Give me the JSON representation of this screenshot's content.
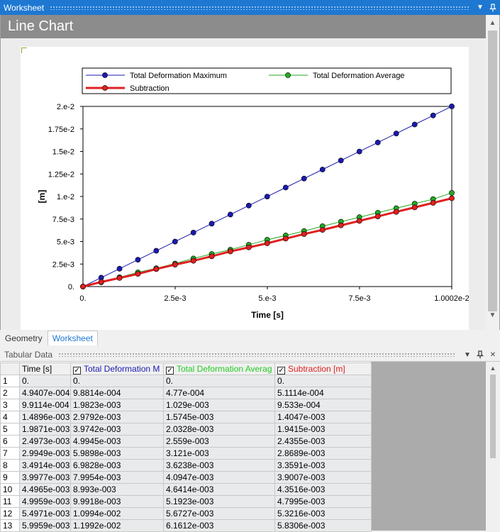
{
  "worksheet": {
    "title": "Worksheet",
    "pin_icon": "pin-icon",
    "dropdown_icon": "dropdown-arrow-icon",
    "header": "Line Chart"
  },
  "chart_data": {
    "type": "line",
    "xlabel": "Time [s]",
    "ylabel": "[m]",
    "xlim": [
      0,
      0.010002
    ],
    "ylim": [
      0,
      0.02
    ],
    "x_ticks": [
      0,
      0.0025,
      0.005,
      0.0075,
      0.010002
    ],
    "x_tick_labels": [
      "0.",
      "2.5e-3",
      "5.e-3",
      "7.5e-3",
      "1.0002e-2"
    ],
    "y_ticks": [
      0,
      0.0025,
      0.005,
      0.0075,
      0.01,
      0.0125,
      0.015,
      0.0175,
      0.02
    ],
    "y_tick_labels": [
      "0.",
      "2.5e-3",
      "5.e-3",
      "7.5e-3",
      "1.e-2",
      "1.25e-2",
      "1.5e-2",
      "1.75e-2",
      "2.e-2"
    ],
    "legend_position": "top",
    "x": [
      0,
      0.00049407,
      0.00099114,
      0.0014896,
      0.0019871,
      0.0024973,
      0.0029949,
      0.0034914,
      0.0039977,
      0.0044965,
      0.0049959,
      0.0054971,
      0.0059959,
      0.0064959,
      0.0069959,
      0.0074959,
      0.0079959,
      0.0084959,
      0.0089959,
      0.0094959,
      0.010002
    ],
    "series": [
      {
        "name": "Total Deformation Maximum",
        "color": "#1a1ab0",
        "values": [
          0,
          0.00098814,
          0.0019823,
          0.0029792,
          0.0039742,
          0.0049945,
          0.0059898,
          0.0069828,
          0.0079954,
          0.008993,
          0.0099918,
          0.010994,
          0.011992,
          0.012992,
          0.013992,
          0.014992,
          0.015992,
          0.016992,
          0.017992,
          0.018992,
          0.020004
        ]
      },
      {
        "name": "Total Deformation Average",
        "color": "#22aa22",
        "values": [
          0,
          0.000477,
          0.001029,
          0.0015745,
          0.0020328,
          0.002559,
          0.003121,
          0.0036238,
          0.0040947,
          0.0046414,
          0.0051923,
          0.0056727,
          0.0061612,
          0.0067,
          0.0072,
          0.0077,
          0.0082,
          0.0087,
          0.0092,
          0.0097,
          0.0104
        ]
      },
      {
        "name": "Subtraction",
        "color": "#e02020",
        "values": [
          0,
          0.00051114,
          0.0009533,
          0.0014047,
          0.0019415,
          0.0024355,
          0.0028689,
          0.0033591,
          0.0039007,
          0.0043516,
          0.0047995,
          0.0053216,
          0.0058306,
          0.00629,
          0.00679,
          0.00729,
          0.00779,
          0.00829,
          0.00879,
          0.00929,
          0.0098
        ]
      }
    ]
  },
  "tabs": [
    {
      "label": "Geometry",
      "active": false
    },
    {
      "label": "Worksheet",
      "active": true
    }
  ],
  "tabular": {
    "title": "Tabular Data",
    "columns": [
      {
        "label": "",
        "color": "#000000",
        "checkbox": false
      },
      {
        "label": "Time [s]",
        "color": "#000000",
        "checkbox": false
      },
      {
        "label": "Total Deformation M",
        "color": "#1a1ab0",
        "checkbox": true
      },
      {
        "label": "Total Deformation Averag",
        "color": "#22cc22",
        "checkbox": true
      },
      {
        "label": "Subtraction [m]",
        "color": "#e02020",
        "checkbox": true
      }
    ],
    "rows": [
      [
        "1",
        "0.",
        "0.",
        "0.",
        "0."
      ],
      [
        "2",
        "4.9407e-004",
        "9.8814e-004",
        "4.77e-004",
        "5.1114e-004"
      ],
      [
        "3",
        "9.9114e-004",
        "1.9823e-003",
        "1.029e-003",
        "9.533e-004"
      ],
      [
        "4",
        "1.4896e-003",
        "2.9792e-003",
        "1.5745e-003",
        "1.4047e-003"
      ],
      [
        "5",
        "1.9871e-003",
        "3.9742e-003",
        "2.0328e-003",
        "1.9415e-003"
      ],
      [
        "6",
        "2.4973e-003",
        "4.9945e-003",
        "2.559e-003",
        "2.4355e-003"
      ],
      [
        "7",
        "2.9949e-003",
        "5.9898e-003",
        "3.121e-003",
        "2.8689e-003"
      ],
      [
        "8",
        "3.4914e-003",
        "6.9828e-003",
        "3.6238e-003",
        "3.3591e-003"
      ],
      [
        "9",
        "3.9977e-003",
        "7.9954e-003",
        "4.0947e-003",
        "3.9007e-003"
      ],
      [
        "10",
        "4.4965e-003",
        "8.993e-003",
        "4.6414e-003",
        "4.3516e-003"
      ],
      [
        "11",
        "4.9959e-003",
        "9.9918e-003",
        "5.1923e-003",
        "4.7995e-003"
      ],
      [
        "12",
        "5.4971e-003",
        "1.0994e-002",
        "5.6727e-003",
        "5.3216e-003"
      ],
      [
        "13",
        "5.9959e-003",
        "1.1992e-002",
        "6.1612e-003",
        "5.8306e-003"
      ]
    ]
  }
}
